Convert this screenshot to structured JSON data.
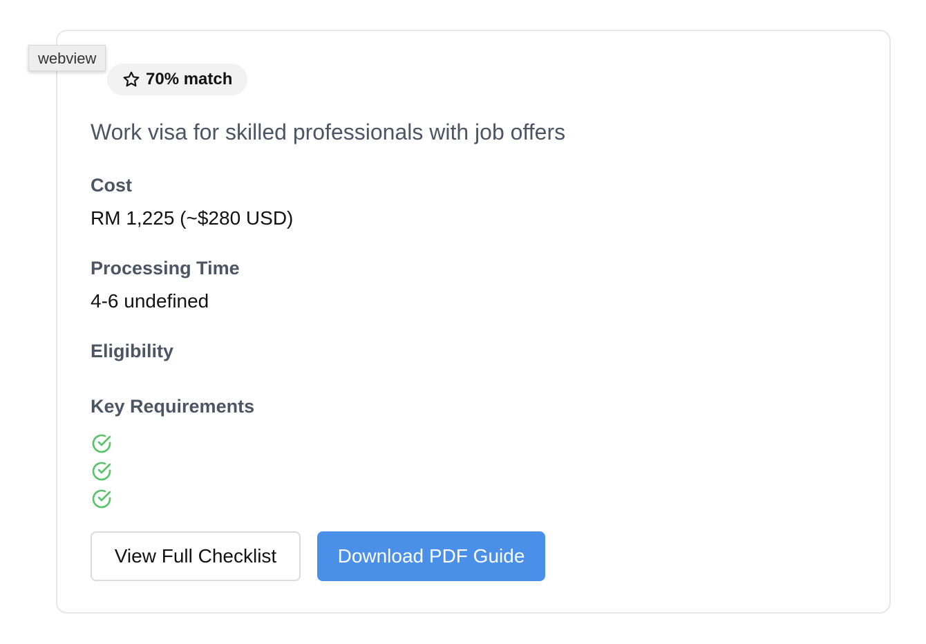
{
  "webview_label": "webview",
  "badge": {
    "icon": "star-outline-icon",
    "text": "70% match"
  },
  "description": "Work visa for skilled professionals with job offers",
  "cost": {
    "label": "Cost",
    "value": "RM 1,225 (~$280 USD)"
  },
  "processing": {
    "label": "Processing Time",
    "value": "4-6 undefined"
  },
  "eligibility": {
    "label": "Eligibility"
  },
  "requirements": {
    "label": "Key Requirements",
    "items": [
      "",
      "",
      ""
    ],
    "icon": "check-circle-icon",
    "icon_color": "#5cc26a"
  },
  "buttons": {
    "checklist": "View Full Checklist",
    "download": "Download PDF Guide"
  },
  "colors": {
    "primary": "#4a90e8",
    "heading": "#4b5563",
    "check": "#5cc26a"
  }
}
